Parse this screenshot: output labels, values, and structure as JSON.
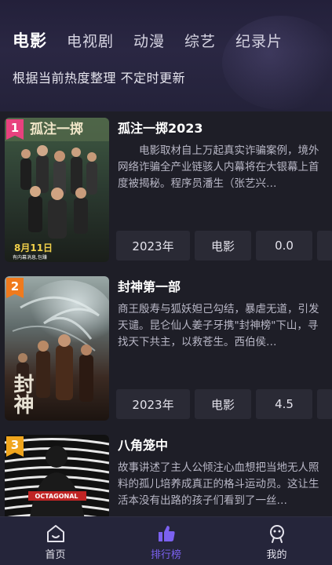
{
  "header": {
    "tabs": [
      {
        "label": "电影"
      },
      {
        "label": "电视剧"
      },
      {
        "label": "动漫"
      },
      {
        "label": "综艺"
      },
      {
        "label": "纪录片"
      }
    ],
    "subtitle": "根据当前热度整理 不定时更新"
  },
  "movies": [
    {
      "rank": "1",
      "rank_color": "#e8417e",
      "title": "孤注一掷2023",
      "description": "　　电影取材自上万起真实诈骗案例，境外网络诈骗全产业链骇人内幕将在大银幕上首度被揭秘。程序员潘生（张艺兴…",
      "year": "2023年",
      "type": "电影",
      "score": "0.0",
      "poster_lettering": "孤注一掷",
      "poster_date": "8月11日",
      "poster_caption": "有内幕消息,包赚"
    },
    {
      "rank": "2",
      "rank_color": "#f07a1d",
      "title": "封神第一部",
      "description": "商王殷寿与狐妖妲己勾结，暴虐无道，引发天谴。昆仑仙人姜子牙携\"封神榜\"下山，寻找天下共主，以救苍生。西伯侯…",
      "year": "2023年",
      "type": "电影",
      "score": "4.5",
      "poster_lettering": "封神"
    },
    {
      "rank": "3",
      "rank_color": "#f0a51d",
      "title": "八角笼中",
      "description": "故事讲述了主人公倾注心血想把当地无人照料的孤儿培养成真正的格斗运动员。这让生活本没有出路的孩子们看到了一丝…",
      "poster_lettering": "OCTAGONAL"
    }
  ],
  "navbar": {
    "items": [
      {
        "label": "首页"
      },
      {
        "label": "排行榜"
      },
      {
        "label": "我的"
      }
    ],
    "active_color": "#7b61f0"
  }
}
